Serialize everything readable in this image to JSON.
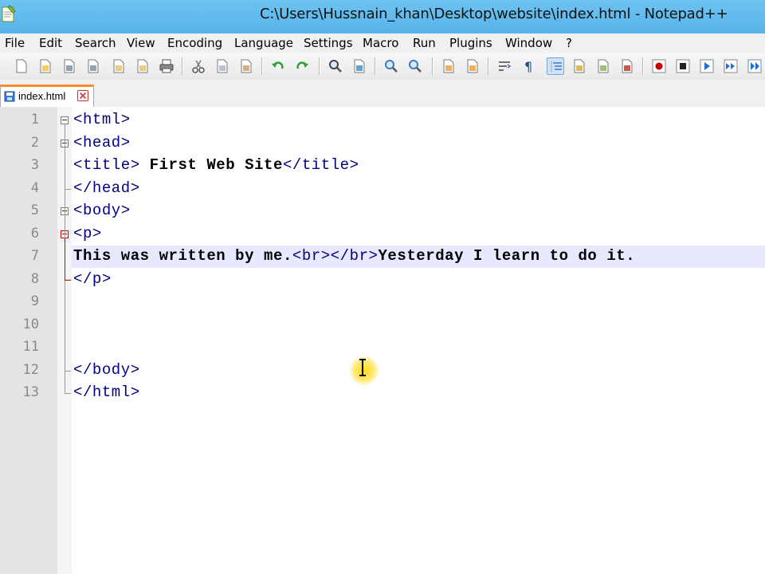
{
  "window": {
    "title": "C:\\Users\\Hussnain_khan\\Desktop\\website\\index.html - Notepad++",
    "app_icon": "notepad-plus-plus-icon"
  },
  "menu": {
    "items": [
      "File",
      "Edit",
      "Search",
      "View",
      "Encoding",
      "Language",
      "Settings",
      "Macro",
      "Run",
      "Plugins",
      "Window",
      "?"
    ]
  },
  "toolbar": {
    "buttons": [
      "new-file-icon",
      "open-file-icon",
      "save-icon",
      "save-all-icon",
      "close-icon",
      "close-all-icon",
      "print-icon",
      "cut-icon",
      "copy-icon",
      "paste-icon",
      "undo-icon",
      "redo-icon",
      "find-icon",
      "replace-icon",
      "zoom-in-icon",
      "zoom-out-icon",
      "sync-vertical-icon",
      "sync-horizontal-icon",
      "word-wrap-icon",
      "show-all-characters-icon",
      "indent-guide-icon",
      "user-defined-language-icon",
      "document-map-icon",
      "function-list-icon",
      "record-macro-icon",
      "stop-recording-icon",
      "playback-macro-icon",
      "run-macro-multiple-icon",
      "save-macro-icon"
    ]
  },
  "tab": {
    "label": "index.html",
    "close_icon": "tab-close-icon"
  },
  "editor": {
    "current_line": 7,
    "lines": [
      {
        "num": "1",
        "tokens": [
          {
            "t": "tag",
            "v": "<html>"
          }
        ]
      },
      {
        "num": "2",
        "tokens": [
          {
            "t": "tag",
            "v": "<head>"
          }
        ]
      },
      {
        "num": "3",
        "tokens": [
          {
            "t": "tag",
            "v": "<title>"
          },
          {
            "t": "txt",
            "v": " First Web Site"
          },
          {
            "t": "tag",
            "v": "</title>"
          }
        ]
      },
      {
        "num": "4",
        "tokens": [
          {
            "t": "tag",
            "v": "</head>"
          }
        ]
      },
      {
        "num": "5",
        "tokens": [
          {
            "t": "tag",
            "v": "<body>"
          }
        ]
      },
      {
        "num": "6",
        "tokens": [
          {
            "t": "tag",
            "v": "<p>"
          }
        ]
      },
      {
        "num": "7",
        "tokens": [
          {
            "t": "txt",
            "v": "This was written by me."
          },
          {
            "t": "tag",
            "v": "<br></br>"
          },
          {
            "t": "txt",
            "v": "Yesterday I learn to do it."
          }
        ]
      },
      {
        "num": "8",
        "tokens": [
          {
            "t": "tag",
            "v": "</p>"
          }
        ]
      },
      {
        "num": "9",
        "tokens": []
      },
      {
        "num": "10",
        "tokens": []
      },
      {
        "num": "11",
        "tokens": []
      },
      {
        "num": "12",
        "tokens": [
          {
            "t": "tag",
            "v": "</body>"
          }
        ]
      },
      {
        "num": "13",
        "tokens": [
          {
            "t": "tag",
            "v": "</html>"
          }
        ]
      }
    ]
  },
  "colors": {
    "titlebar": "#6dc3f2",
    "tag": "#000080",
    "current_line": "#e8e8ff",
    "tab_accent": "#fa8c2c"
  }
}
